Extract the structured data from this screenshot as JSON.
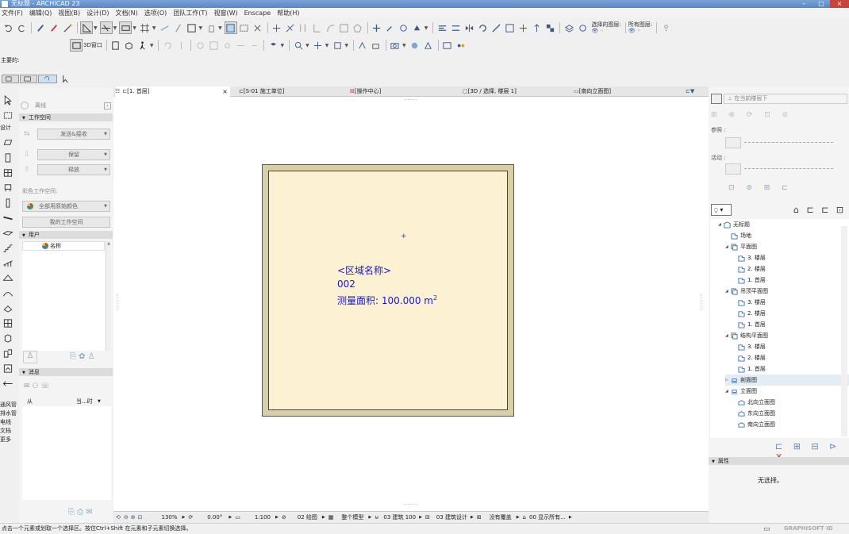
{
  "window": {
    "title": "无标题 - ARCHICAD 23",
    "buttons": [
      "–",
      "□",
      "×"
    ]
  },
  "menu": [
    "文件(F)",
    "编辑(Q)",
    "视图(B)",
    "设计(D)",
    "文档(N)",
    "选项(O)",
    "团队工作(T)",
    "视窗(W)",
    "Enscape",
    "帮助(H)"
  ],
  "toolbar": {
    "window3d_label": "3D窗口",
    "selected_layers_label": "选择的图层:",
    "all_layers_label": "所有图层:"
  },
  "toolbox": {
    "main_label": "主要的:",
    "design_label": "设计",
    "bottom_labels": [
      "通风管",
      "排水管",
      "电线",
      "文档",
      "更多"
    ]
  },
  "teamwork": {
    "offline_label": "离线",
    "workspace_header": "工作空间",
    "send_receive": "发送&接收",
    "reserve": "保留",
    "release": "释放",
    "color_workspace_label": "彩色工作空间:",
    "color_select": "全部用原始颜色",
    "my_workspace": "我的工作空间",
    "users_header": "用户",
    "user_name_header": "名称",
    "messages_header": "消息",
    "from_col": "从",
    "time_col": "当...时"
  },
  "tabs": [
    {
      "label": "[1. 首层]",
      "active": true
    },
    {
      "label": "[S-01 施工单位]",
      "active": false
    },
    {
      "label": "[操作中心]",
      "active": false
    },
    {
      "label": "[3D / 选择, 楼层 1]",
      "active": false
    },
    {
      "label": "[南向立面图]",
      "active": false
    }
  ],
  "zone": {
    "name": "<区域名称>",
    "number": "002",
    "area_prefix": "测量面积: 100.000 m",
    "area_sup": "2"
  },
  "statusbar": {
    "zoom": "130%",
    "angle": "0.00°",
    "scale": "1:100",
    "layer_combo": "02 绘图",
    "model_view": "整个模型",
    "dim": "03 建筑 100",
    "model_view_option": "03 建筑设计",
    "override": "没有覆盖",
    "renovation": "00 显示所有..."
  },
  "status_message": "点击一个元素或划取一个选择区。按住Ctrl+Shift 在元素和子元素切换选择。",
  "graphisoft_id": "GRAPHISOFT ID",
  "right_panel": {
    "layer_label": "在当前楼层下",
    "reference_label": "参照 :",
    "active_label": "活动 :"
  },
  "navigator": {
    "items": [
      {
        "label": "无标题",
        "level": 0,
        "icon": "project-icon",
        "expander": "open"
      },
      {
        "label": "场地",
        "level": 1,
        "icon": "story-icon",
        "expander": ""
      },
      {
        "label": "平面图",
        "level": 1,
        "icon": "folder-icon",
        "expander": "open"
      },
      {
        "label": "3. 楼层",
        "level": 2,
        "icon": "story-icon",
        "expander": ""
      },
      {
        "label": "2. 楼层",
        "level": 2,
        "icon": "story-icon",
        "expander": ""
      },
      {
        "label": "1. 首层",
        "level": 2,
        "icon": "story-icon",
        "expander": ""
      },
      {
        "label": "吊顶平面图",
        "level": 1,
        "icon": "folder-icon",
        "expander": "open"
      },
      {
        "label": "3. 楼层",
        "level": 2,
        "icon": "story-icon",
        "expander": ""
      },
      {
        "label": "2. 楼层",
        "level": 2,
        "icon": "story-icon",
        "expander": ""
      },
      {
        "label": "1. 首层",
        "level": 2,
        "icon": "story-icon",
        "expander": ""
      },
      {
        "label": "结构平面图",
        "level": 1,
        "icon": "folder-icon",
        "expander": "open"
      },
      {
        "label": "3. 楼层",
        "level": 2,
        "icon": "story-icon",
        "expander": ""
      },
      {
        "label": "2. 楼层",
        "level": 2,
        "icon": "story-icon",
        "expander": ""
      },
      {
        "label": "1. 首层",
        "level": 2,
        "icon": "story-icon",
        "expander": ""
      },
      {
        "label": "剖面图",
        "level": 1,
        "icon": "section-icon",
        "expander": "closed"
      },
      {
        "label": "立面图",
        "level": 1,
        "icon": "section-icon",
        "expander": "open"
      },
      {
        "label": "北向立面图",
        "level": 2,
        "icon": "elevation-icon",
        "expander": ""
      },
      {
        "label": "东向立面图",
        "level": 2,
        "icon": "elevation-icon",
        "expander": ""
      },
      {
        "label": "南向立面图",
        "level": 2,
        "icon": "elevation-icon",
        "expander": ""
      }
    ]
  },
  "properties": {
    "header": "属性",
    "empty": "无选择。"
  },
  "colors": {
    "zone_fill": "#fdf1d3",
    "wall_fill": "#d8cfa6",
    "zone_text": "#1a1acc",
    "accent": "#3a5a8c"
  }
}
